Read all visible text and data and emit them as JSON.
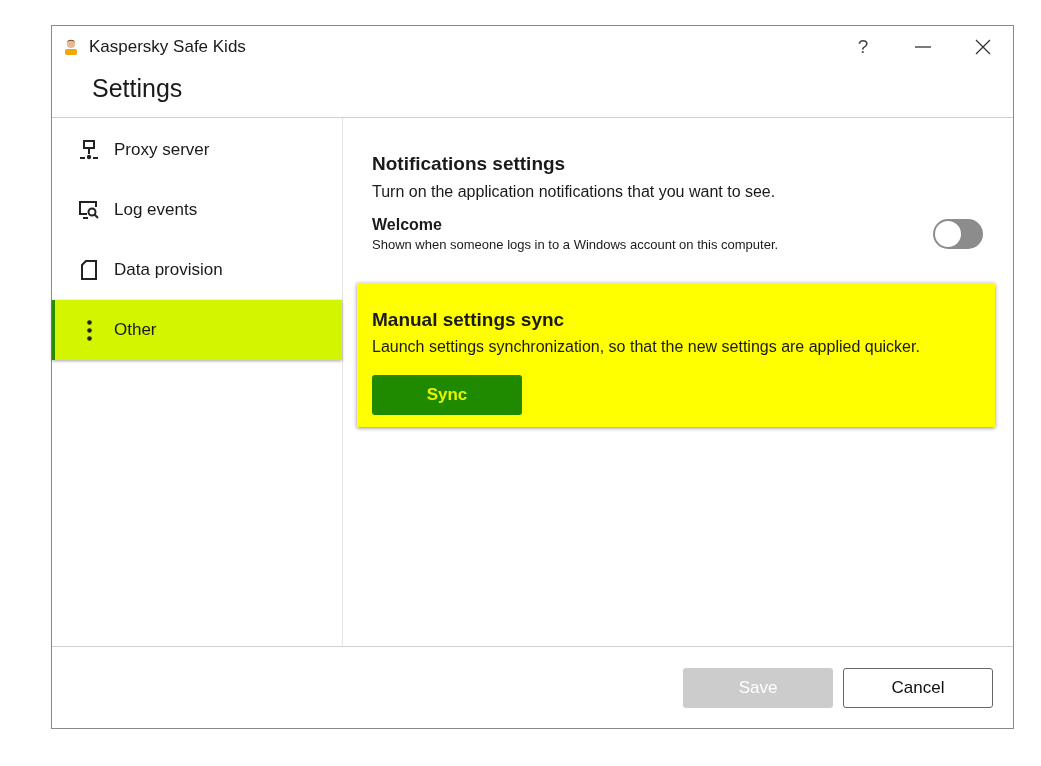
{
  "window": {
    "title": "Kaspersky Safe Kids",
    "help": "?"
  },
  "header": {
    "title": "Settings"
  },
  "sidebar": {
    "items": [
      {
        "label": "Proxy server",
        "kind": "proxy",
        "selected": false
      },
      {
        "label": "Log events",
        "kind": "log",
        "selected": false
      },
      {
        "label": "Data provision",
        "kind": "document",
        "selected": false
      },
      {
        "label": "Other",
        "kind": "more",
        "selected": true
      }
    ]
  },
  "notifications": {
    "title": "Notifications settings",
    "description": "Turn on the application notifications that you want to see.",
    "items": [
      {
        "title": "Welcome",
        "description": "Shown when someone logs in to a Windows account on this computer.",
        "on": false
      }
    ]
  },
  "sync_card": {
    "title": "Manual settings sync",
    "description": "Launch settings synchronization, so that the new settings are applied quicker.",
    "button": "Sync"
  },
  "footer": {
    "buttons": [
      {
        "label": "Save",
        "disabled": true
      },
      {
        "label": "Cancel",
        "disabled": false
      }
    ]
  }
}
